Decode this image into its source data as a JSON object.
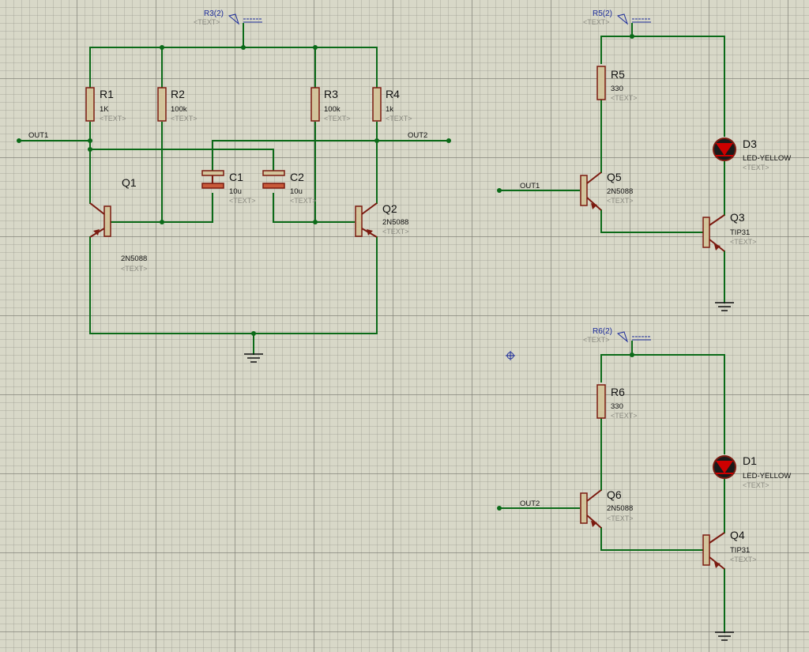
{
  "components": {
    "R1": {
      "ref": "R1",
      "value": "1K",
      "text": "<TEXT>"
    },
    "R2": {
      "ref": "R2",
      "value": "100k",
      "text": "<TEXT>"
    },
    "R3": {
      "ref": "R3",
      "value": "100k",
      "text": "<TEXT>"
    },
    "R4": {
      "ref": "R4",
      "value": "1k",
      "text": "<TEXT>"
    },
    "R5": {
      "ref": "R5",
      "value": "330",
      "text": "<TEXT>"
    },
    "R6": {
      "ref": "R6",
      "value": "330",
      "text": "<TEXT>"
    },
    "C1": {
      "ref": "C1",
      "value": "10u",
      "text": "<TEXT>"
    },
    "C2": {
      "ref": "C2",
      "value": "10u",
      "text": "<TEXT>"
    },
    "Q1": {
      "ref": "Q1",
      "value": "2N5088",
      "text": "<TEXT>"
    },
    "Q2": {
      "ref": "Q2",
      "value": "2N5088",
      "text": "<TEXT>"
    },
    "Q3": {
      "ref": "Q3",
      "value": "TIP31",
      "text": "<TEXT>"
    },
    "Q4": {
      "ref": "Q4",
      "value": "TIP31",
      "text": "<TEXT>"
    },
    "Q5": {
      "ref": "Q5",
      "value": "2N5088",
      "text": "<TEXT>"
    },
    "Q6": {
      "ref": "Q6",
      "value": "2N5088",
      "text": "<TEXT>"
    },
    "D1": {
      "ref": "D1",
      "value": "LED-YELLOW",
      "text": "<TEXT>"
    },
    "D3": {
      "ref": "D3",
      "value": "LED-YELLOW",
      "text": "<TEXT>"
    }
  },
  "power_terminals": {
    "p1": {
      "label": "R3(2)",
      "text": "<TEXT>"
    },
    "p2": {
      "label": "R5(2)",
      "text": "<TEXT>"
    },
    "p3": {
      "label": "R6(2)",
      "text": "<TEXT>"
    }
  },
  "net_labels": {
    "out1_left": "OUT1",
    "out2_left": "OUT2",
    "out1_q5": "OUT1",
    "out2_q6": "OUT2"
  },
  "colors": {
    "wire": "#0b6a18",
    "component": "#7b1a10",
    "background": "#d8d8c8",
    "led_fill": "#7a0000"
  }
}
